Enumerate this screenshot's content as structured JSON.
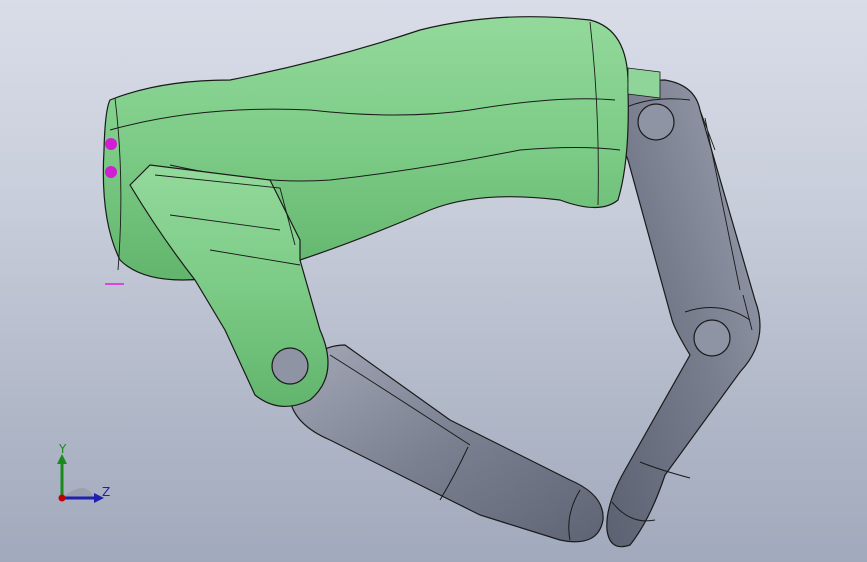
{
  "viewport": {
    "background_top": "#d9dde8",
    "background_bottom": "#a1a9bc"
  },
  "model": {
    "palm_color": "#7ccb86",
    "palm_edge_color": "#1a1a1a",
    "finger_color": "#767b8c",
    "finger_highlight": "#9a9fae",
    "highlight_color": "#e100e1"
  },
  "axis_triad": {
    "y_label": "Y",
    "z_label": "Z",
    "y_color": "#1a8a1a",
    "z_color": "#1f1fb0",
    "x_color": "#c00000"
  }
}
